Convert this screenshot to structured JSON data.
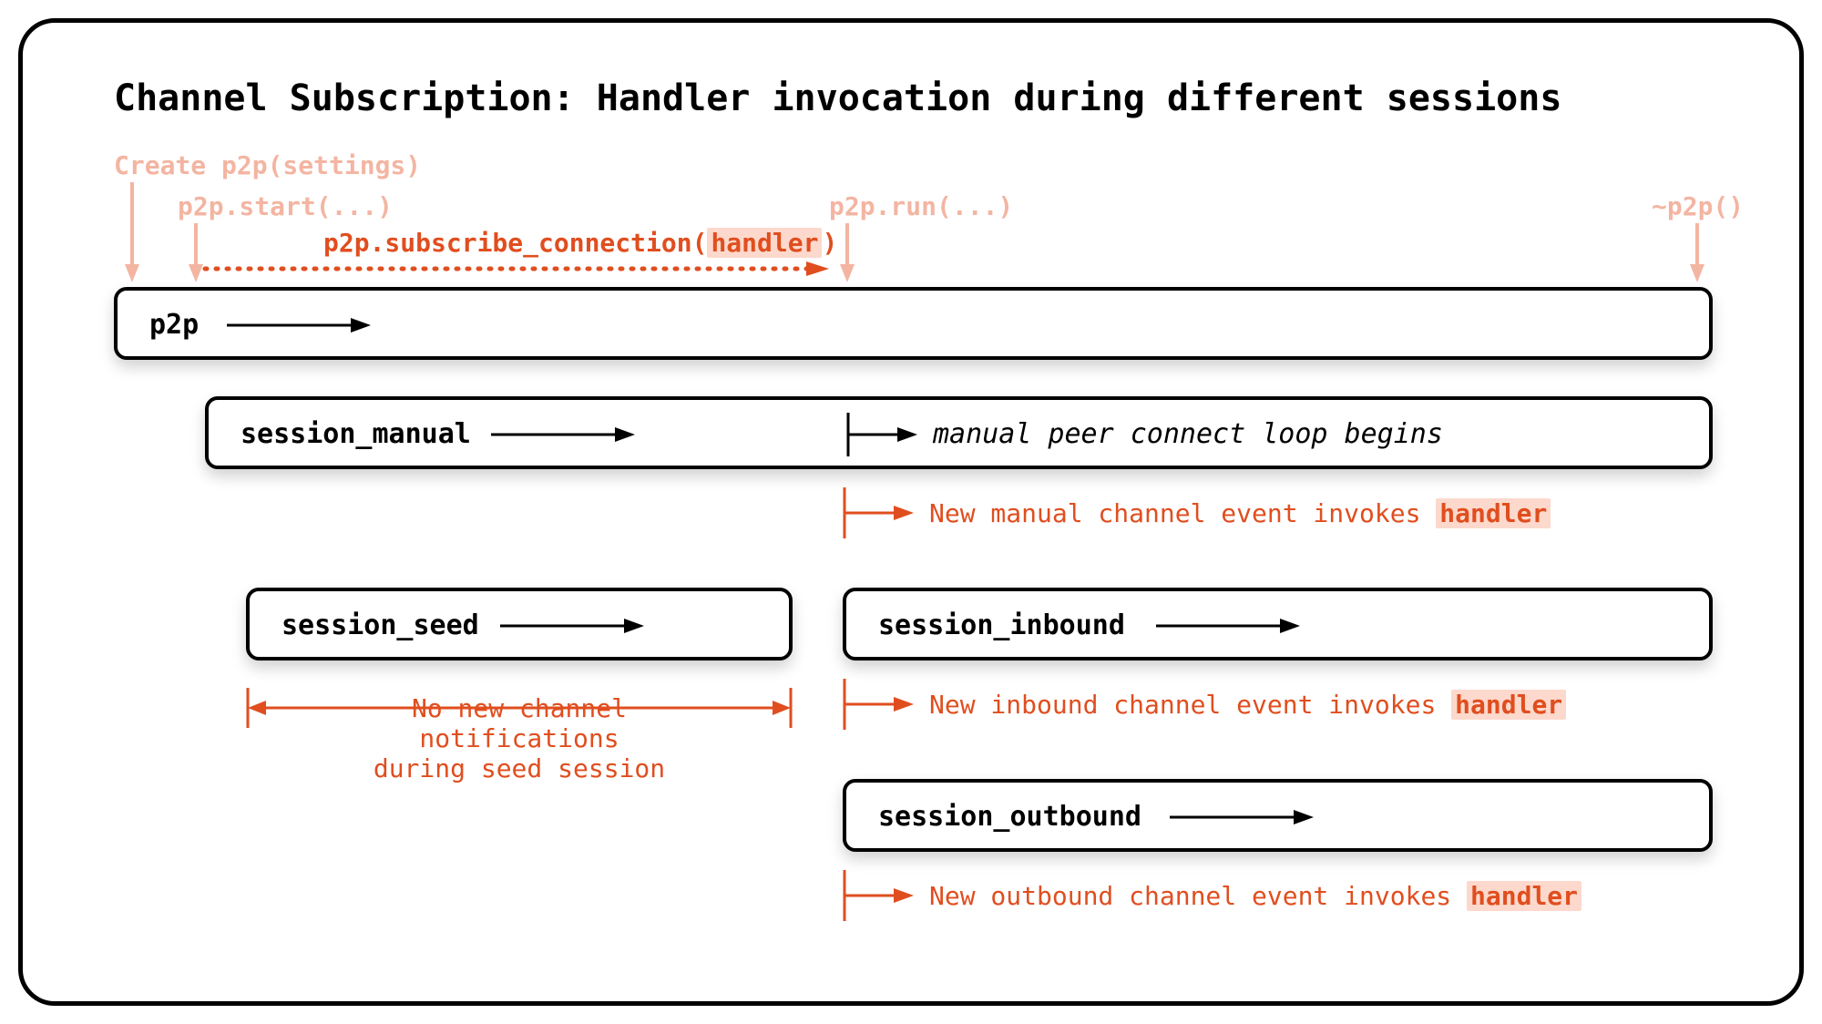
{
  "title": "Channel Subscription: Handler invocation during different sessions",
  "labels": {
    "create": "Create p2p(settings)",
    "start": "p2p.start(...)",
    "subscribe_pre": "p2p.subscribe_connection(",
    "subscribe_hl": "handler",
    "subscribe_post": ")",
    "run": "p2p.run(...)",
    "destruct": "~p2p()"
  },
  "boxes": {
    "p2p": "p2p",
    "manual": "session_manual",
    "manual_note": "manual peer connect loop begins",
    "seed": "session_seed",
    "inbound": "session_inbound",
    "outbound": "session_outbound"
  },
  "annotations": {
    "manual_event_pre": "New manual channel event invokes ",
    "manual_event_hl": "handler",
    "seed_note_l1": "No new channel notifications",
    "seed_note_l2": "during seed session",
    "inbound_event_pre": "New inbound channel event invokes ",
    "inbound_event_hl": "handler",
    "outbound_event_pre": "New outbound channel event invokes ",
    "outbound_event_hl": "handler"
  }
}
